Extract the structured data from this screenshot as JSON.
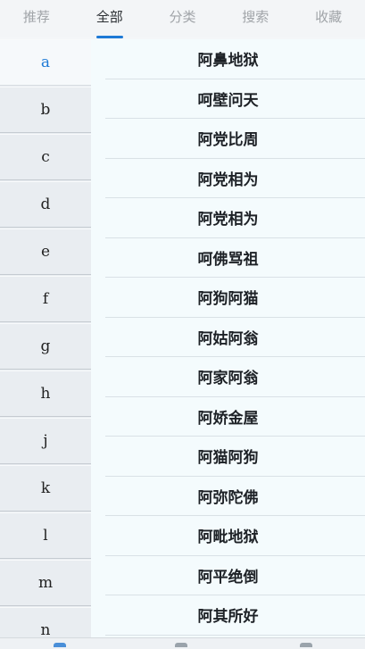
{
  "tabs": [
    {
      "label": "推荐"
    },
    {
      "label": "全部"
    },
    {
      "label": "分类"
    },
    {
      "label": "搜索"
    },
    {
      "label": "收藏"
    }
  ],
  "active_tab": "全部",
  "letters": [
    "a",
    "b",
    "c",
    "d",
    "e",
    "f",
    "g",
    "h",
    "j",
    "k",
    "l",
    "m",
    "n"
  ],
  "active_letter": "a",
  "idioms": [
    "阿鼻地狱",
    "呵壁问天",
    "阿党比周",
    "阿党相为",
    "阿党相为",
    "呵佛骂祖",
    "阿狗阿猫",
    "阿姑阿翁",
    "阿家阿翁",
    "阿娇金屋",
    "阿猫阿狗",
    "阿弥陀佛",
    "阿毗地狱",
    "阿平绝倒",
    "阿其所好"
  ],
  "colors": {
    "accent": "#1e7ad6"
  },
  "bottom_nav_icons": [
    "home-icon",
    "book-icon",
    "profile-icon"
  ]
}
